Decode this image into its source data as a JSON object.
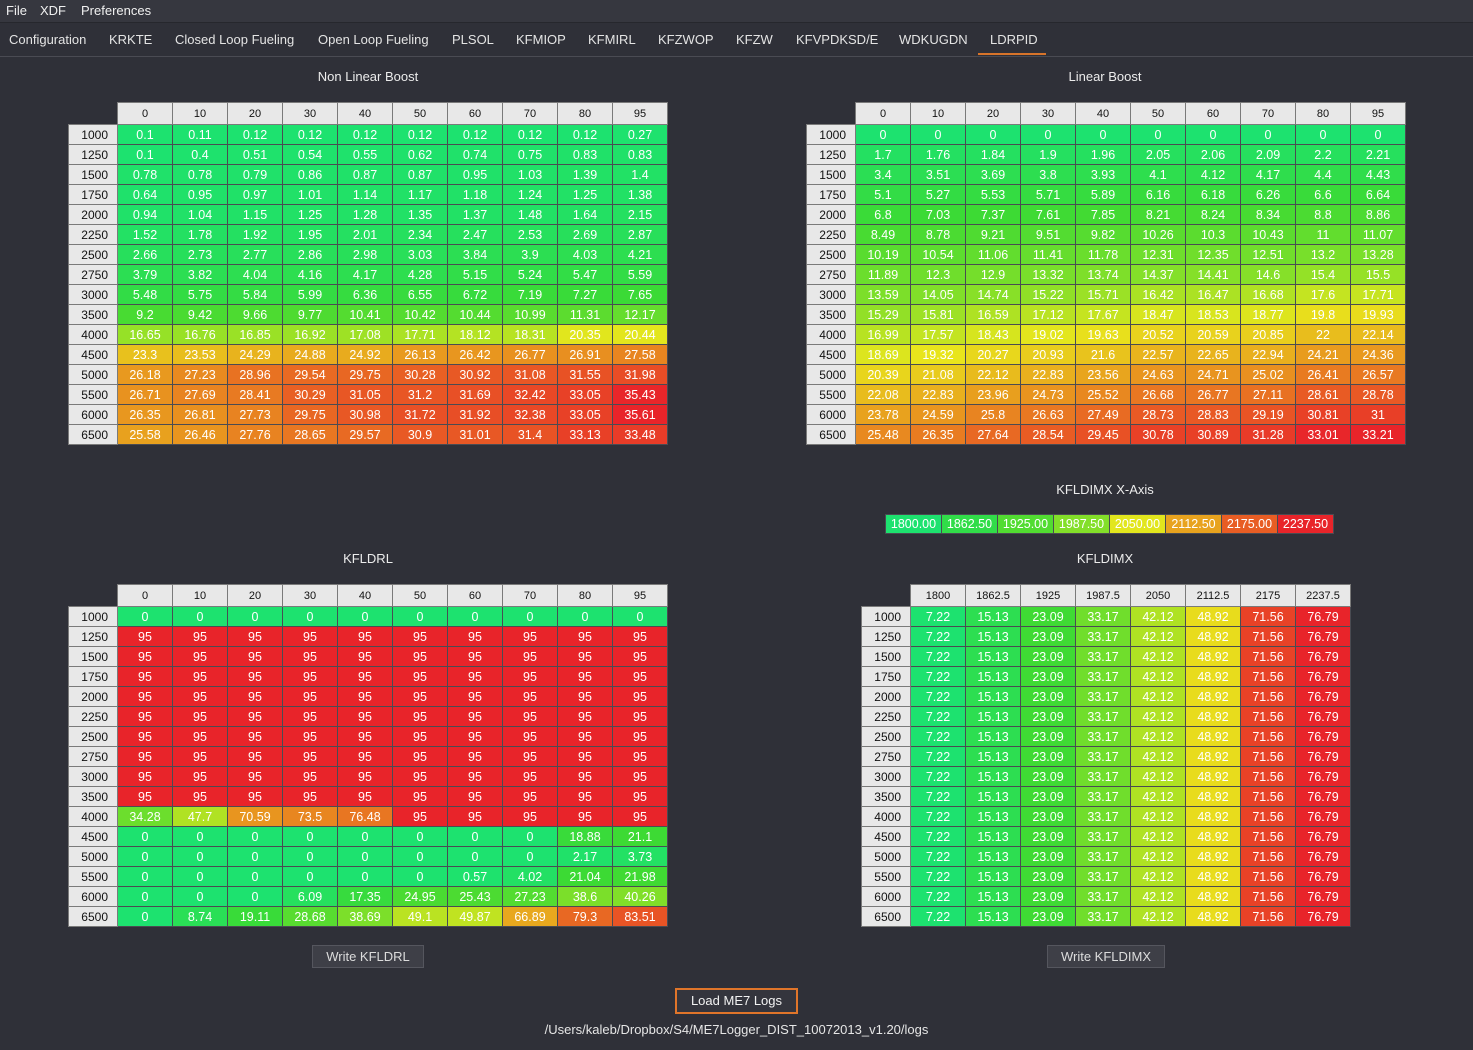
{
  "menu": {
    "items": [
      "File",
      "XDF",
      "Preferences"
    ]
  },
  "tabs": [
    "Configuration",
    "KRKTE",
    "Closed Loop Fueling",
    "Open Loop Fueling",
    "PLSOL",
    "KFMIOP",
    "KFMIRL",
    "KFZWOP",
    "KFZW",
    "KFVPDKSD/E",
    "WDKUGDN",
    "LDRPID"
  ],
  "active_tab": "LDRPID",
  "colors": {
    "background": "#2f3038",
    "accent": "#e0752a",
    "header_cell": "#e8e8e8",
    "heat_low": "#1de26f",
    "heat_mid": "#e8e61c",
    "heat_high": "#e8242a"
  },
  "panels": {
    "non_linear_boost": {
      "title": "Non Linear Boost",
      "columns": [
        "0",
        "10",
        "20",
        "30",
        "40",
        "50",
        "60",
        "70",
        "80",
        "95"
      ],
      "rows": [
        {
          "rpm": "1000",
          "values": [
            "0.1",
            "0.11",
            "0.12",
            "0.12",
            "0.12",
            "0.12",
            "0.12",
            "0.12",
            "0.12",
            "0.27"
          ]
        },
        {
          "rpm": "1250",
          "values": [
            "0.1",
            "0.4",
            "0.51",
            "0.54",
            "0.55",
            "0.62",
            "0.74",
            "0.75",
            "0.83",
            "0.83"
          ]
        },
        {
          "rpm": "1500",
          "values": [
            "0.78",
            "0.78",
            "0.79",
            "0.86",
            "0.87",
            "0.87",
            "0.95",
            "1.03",
            "1.39",
            "1.4"
          ]
        },
        {
          "rpm": "1750",
          "values": [
            "0.64",
            "0.95",
            "0.97",
            "1.01",
            "1.14",
            "1.17",
            "1.18",
            "1.24",
            "1.25",
            "1.38"
          ]
        },
        {
          "rpm": "2000",
          "values": [
            "0.94",
            "1.04",
            "1.15",
            "1.25",
            "1.28",
            "1.35",
            "1.37",
            "1.48",
            "1.64",
            "2.15"
          ]
        },
        {
          "rpm": "2250",
          "values": [
            "1.52",
            "1.78",
            "1.92",
            "1.95",
            "2.01",
            "2.34",
            "2.47",
            "2.53",
            "2.69",
            "2.87"
          ]
        },
        {
          "rpm": "2500",
          "values": [
            "2.66",
            "2.73",
            "2.77",
            "2.86",
            "2.98",
            "3.03",
            "3.84",
            "3.9",
            "4.03",
            "4.21"
          ]
        },
        {
          "rpm": "2750",
          "values": [
            "3.79",
            "3.82",
            "4.04",
            "4.16",
            "4.17",
            "4.28",
            "5.15",
            "5.24",
            "5.47",
            "5.59"
          ]
        },
        {
          "rpm": "3000",
          "values": [
            "5.48",
            "5.75",
            "5.84",
            "5.99",
            "6.36",
            "6.55",
            "6.72",
            "7.19",
            "7.27",
            "7.65"
          ]
        },
        {
          "rpm": "3500",
          "values": [
            "9.2",
            "9.42",
            "9.66",
            "9.77",
            "10.41",
            "10.42",
            "10.44",
            "10.99",
            "11.31",
            "12.17"
          ]
        },
        {
          "rpm": "4000",
          "values": [
            "16.65",
            "16.76",
            "16.85",
            "16.92",
            "17.08",
            "17.71",
            "18.12",
            "18.31",
            "20.35",
            "20.44"
          ]
        },
        {
          "rpm": "4500",
          "values": [
            "23.3",
            "23.53",
            "24.29",
            "24.88",
            "24.92",
            "26.13",
            "26.42",
            "26.77",
            "26.91",
            "27.58"
          ]
        },
        {
          "rpm": "5000",
          "values": [
            "26.18",
            "27.23",
            "28.96",
            "29.54",
            "29.75",
            "30.28",
            "30.92",
            "31.08",
            "31.55",
            "31.98"
          ]
        },
        {
          "rpm": "5500",
          "values": [
            "26.71",
            "27.69",
            "28.41",
            "30.29",
            "31.05",
            "31.2",
            "31.69",
            "32.42",
            "33.05",
            "35.43"
          ]
        },
        {
          "rpm": "6000",
          "values": [
            "26.35",
            "26.81",
            "27.73",
            "29.75",
            "30.98",
            "31.72",
            "31.92",
            "32.38",
            "33.05",
            "35.61"
          ]
        },
        {
          "rpm": "6500",
          "values": [
            "25.58",
            "26.46",
            "27.76",
            "28.65",
            "29.57",
            "30.9",
            "31.01",
            "31.4",
            "33.13",
            "33.48"
          ]
        }
      ]
    },
    "linear_boost": {
      "title": "Linear Boost",
      "columns": [
        "0",
        "10",
        "20",
        "30",
        "40",
        "50",
        "60",
        "70",
        "80",
        "95"
      ],
      "rows": [
        {
          "rpm": "1000",
          "values": [
            "0",
            "0",
            "0",
            "0",
            "0",
            "0",
            "0",
            "0",
            "0",
            "0"
          ]
        },
        {
          "rpm": "1250",
          "values": [
            "1.7",
            "1.76",
            "1.84",
            "1.9",
            "1.96",
            "2.05",
            "2.06",
            "2.09",
            "2.2",
            "2.21"
          ]
        },
        {
          "rpm": "1500",
          "values": [
            "3.4",
            "3.51",
            "3.69",
            "3.8",
            "3.93",
            "4.1",
            "4.12",
            "4.17",
            "4.4",
            "4.43"
          ]
        },
        {
          "rpm": "1750",
          "values": [
            "5.1",
            "5.27",
            "5.53",
            "5.71",
            "5.89",
            "6.16",
            "6.18",
            "6.26",
            "6.6",
            "6.64"
          ]
        },
        {
          "rpm": "2000",
          "values": [
            "6.8",
            "7.03",
            "7.37",
            "7.61",
            "7.85",
            "8.21",
            "8.24",
            "8.34",
            "8.8",
            "8.86"
          ]
        },
        {
          "rpm": "2250",
          "values": [
            "8.49",
            "8.78",
            "9.21",
            "9.51",
            "9.82",
            "10.26",
            "10.3",
            "10.43",
            "11",
            "11.07"
          ]
        },
        {
          "rpm": "2500",
          "values": [
            "10.19",
            "10.54",
            "11.06",
            "11.41",
            "11.78",
            "12.31",
            "12.35",
            "12.51",
            "13.2",
            "13.28"
          ]
        },
        {
          "rpm": "2750",
          "values": [
            "11.89",
            "12.3",
            "12.9",
            "13.32",
            "13.74",
            "14.37",
            "14.41",
            "14.6",
            "15.4",
            "15.5"
          ]
        },
        {
          "rpm": "3000",
          "values": [
            "13.59",
            "14.05",
            "14.74",
            "15.22",
            "15.71",
            "16.42",
            "16.47",
            "16.68",
            "17.6",
            "17.71"
          ]
        },
        {
          "rpm": "3500",
          "values": [
            "15.29",
            "15.81",
            "16.59",
            "17.12",
            "17.67",
            "18.47",
            "18.53",
            "18.77",
            "19.8",
            "19.93"
          ]
        },
        {
          "rpm": "4000",
          "values": [
            "16.99",
            "17.57",
            "18.43",
            "19.02",
            "19.63",
            "20.52",
            "20.59",
            "20.85",
            "22",
            "22.14"
          ]
        },
        {
          "rpm": "4500",
          "values": [
            "18.69",
            "19.32",
            "20.27",
            "20.93",
            "21.6",
            "22.57",
            "22.65",
            "22.94",
            "24.21",
            "24.36"
          ]
        },
        {
          "rpm": "5000",
          "values": [
            "20.39",
            "21.08",
            "22.12",
            "22.83",
            "23.56",
            "24.63",
            "24.71",
            "25.02",
            "26.41",
            "26.57"
          ]
        },
        {
          "rpm": "5500",
          "values": [
            "22.08",
            "22.83",
            "23.96",
            "24.73",
            "25.52",
            "26.68",
            "26.77",
            "27.11",
            "28.61",
            "28.78"
          ]
        },
        {
          "rpm": "6000",
          "values": [
            "23.78",
            "24.59",
            "25.8",
            "26.63",
            "27.49",
            "28.73",
            "28.83",
            "29.19",
            "30.81",
            "31"
          ]
        },
        {
          "rpm": "6500",
          "values": [
            "25.48",
            "26.35",
            "27.64",
            "28.54",
            "29.45",
            "30.78",
            "30.89",
            "31.28",
            "33.01",
            "33.21"
          ]
        }
      ]
    },
    "kfldrl": {
      "title": "KFLDRL",
      "columns": [
        "0",
        "10",
        "20",
        "30",
        "40",
        "50",
        "60",
        "70",
        "80",
        "95"
      ],
      "rows": [
        {
          "rpm": "1000",
          "values": [
            "0",
            "0",
            "0",
            "0",
            "0",
            "0",
            "0",
            "0",
            "0",
            "0"
          ]
        },
        {
          "rpm": "1250",
          "values": [
            "95",
            "95",
            "95",
            "95",
            "95",
            "95",
            "95",
            "95",
            "95",
            "95"
          ]
        },
        {
          "rpm": "1500",
          "values": [
            "95",
            "95",
            "95",
            "95",
            "95",
            "95",
            "95",
            "95",
            "95",
            "95"
          ]
        },
        {
          "rpm": "1750",
          "values": [
            "95",
            "95",
            "95",
            "95",
            "95",
            "95",
            "95",
            "95",
            "95",
            "95"
          ]
        },
        {
          "rpm": "2000",
          "values": [
            "95",
            "95",
            "95",
            "95",
            "95",
            "95",
            "95",
            "95",
            "95",
            "95"
          ]
        },
        {
          "rpm": "2250",
          "values": [
            "95",
            "95",
            "95",
            "95",
            "95",
            "95",
            "95",
            "95",
            "95",
            "95"
          ]
        },
        {
          "rpm": "2500",
          "values": [
            "95",
            "95",
            "95",
            "95",
            "95",
            "95",
            "95",
            "95",
            "95",
            "95"
          ]
        },
        {
          "rpm": "2750",
          "values": [
            "95",
            "95",
            "95",
            "95",
            "95",
            "95",
            "95",
            "95",
            "95",
            "95"
          ]
        },
        {
          "rpm": "3000",
          "values": [
            "95",
            "95",
            "95",
            "95",
            "95",
            "95",
            "95",
            "95",
            "95",
            "95"
          ]
        },
        {
          "rpm": "3500",
          "values": [
            "95",
            "95",
            "95",
            "95",
            "95",
            "95",
            "95",
            "95",
            "95",
            "95"
          ]
        },
        {
          "rpm": "4000",
          "values": [
            "34.28",
            "47.7",
            "70.59",
            "73.5",
            "76.48",
            "95",
            "95",
            "95",
            "95",
            "95"
          ]
        },
        {
          "rpm": "4500",
          "values": [
            "0",
            "0",
            "0",
            "0",
            "0",
            "0",
            "0",
            "0",
            "18.88",
            "21.1"
          ]
        },
        {
          "rpm": "5000",
          "values": [
            "0",
            "0",
            "0",
            "0",
            "0",
            "0",
            "0",
            "0",
            "2.17",
            "3.73"
          ]
        },
        {
          "rpm": "5500",
          "values": [
            "0",
            "0",
            "0",
            "0",
            "0",
            "0",
            "0.57",
            "4.02",
            "21.04",
            "21.98"
          ]
        },
        {
          "rpm": "6000",
          "values": [
            "0",
            "0",
            "0",
            "6.09",
            "17.35",
            "24.95",
            "25.43",
            "27.23",
            "38.6",
            "40.26"
          ]
        },
        {
          "rpm": "6500",
          "values": [
            "0",
            "8.74",
            "19.11",
            "28.68",
            "38.69",
            "49.1",
            "49.87",
            "66.89",
            "79.3",
            "83.51"
          ]
        }
      ],
      "button": "Write KFLDRL"
    },
    "kfldimx_axis": {
      "title": "KFLDIMX X-Axis",
      "values": [
        "1800.00",
        "1862.50",
        "1925.00",
        "1987.50",
        "2050.00",
        "2112.50",
        "2175.00",
        "2237.50"
      ]
    },
    "kfldimx": {
      "title": "KFLDIMX",
      "columns": [
        "1800",
        "1862.5",
        "1925",
        "1987.5",
        "2050",
        "2112.5",
        "2175",
        "2237.5"
      ],
      "rows": [
        {
          "rpm": "1000",
          "values": [
            "7.22",
            "15.13",
            "23.09",
            "33.17",
            "42.12",
            "48.92",
            "71.56",
            "76.79"
          ]
        },
        {
          "rpm": "1250",
          "values": [
            "7.22",
            "15.13",
            "23.09",
            "33.17",
            "42.12",
            "48.92",
            "71.56",
            "76.79"
          ]
        },
        {
          "rpm": "1500",
          "values": [
            "7.22",
            "15.13",
            "23.09",
            "33.17",
            "42.12",
            "48.92",
            "71.56",
            "76.79"
          ]
        },
        {
          "rpm": "1750",
          "values": [
            "7.22",
            "15.13",
            "23.09",
            "33.17",
            "42.12",
            "48.92",
            "71.56",
            "76.79"
          ]
        },
        {
          "rpm": "2000",
          "values": [
            "7.22",
            "15.13",
            "23.09",
            "33.17",
            "42.12",
            "48.92",
            "71.56",
            "76.79"
          ]
        },
        {
          "rpm": "2250",
          "values": [
            "7.22",
            "15.13",
            "23.09",
            "33.17",
            "42.12",
            "48.92",
            "71.56",
            "76.79"
          ]
        },
        {
          "rpm": "2500",
          "values": [
            "7.22",
            "15.13",
            "23.09",
            "33.17",
            "42.12",
            "48.92",
            "71.56",
            "76.79"
          ]
        },
        {
          "rpm": "2750",
          "values": [
            "7.22",
            "15.13",
            "23.09",
            "33.17",
            "42.12",
            "48.92",
            "71.56",
            "76.79"
          ]
        },
        {
          "rpm": "3000",
          "values": [
            "7.22",
            "15.13",
            "23.09",
            "33.17",
            "42.12",
            "48.92",
            "71.56",
            "76.79"
          ]
        },
        {
          "rpm": "3500",
          "values": [
            "7.22",
            "15.13",
            "23.09",
            "33.17",
            "42.12",
            "48.92",
            "71.56",
            "76.79"
          ]
        },
        {
          "rpm": "4000",
          "values": [
            "7.22",
            "15.13",
            "23.09",
            "33.17",
            "42.12",
            "48.92",
            "71.56",
            "76.79"
          ]
        },
        {
          "rpm": "4500",
          "values": [
            "7.22",
            "15.13",
            "23.09",
            "33.17",
            "42.12",
            "48.92",
            "71.56",
            "76.79"
          ]
        },
        {
          "rpm": "5000",
          "values": [
            "7.22",
            "15.13",
            "23.09",
            "33.17",
            "42.12",
            "48.92",
            "71.56",
            "76.79"
          ]
        },
        {
          "rpm": "5500",
          "values": [
            "7.22",
            "15.13",
            "23.09",
            "33.17",
            "42.12",
            "48.92",
            "71.56",
            "76.79"
          ]
        },
        {
          "rpm": "6000",
          "values": [
            "7.22",
            "15.13",
            "23.09",
            "33.17",
            "42.12",
            "48.92",
            "71.56",
            "76.79"
          ]
        },
        {
          "rpm": "6500",
          "values": [
            "7.22",
            "15.13",
            "23.09",
            "33.17",
            "42.12",
            "48.92",
            "71.56",
            "76.79"
          ]
        }
      ],
      "button": "Write KFLDIMX"
    }
  },
  "load_button": "Load ME7 Logs",
  "logs_path": "/Users/kaleb/Dropbox/S4/ME7Logger_DIST_10072013_v1.20/logs"
}
